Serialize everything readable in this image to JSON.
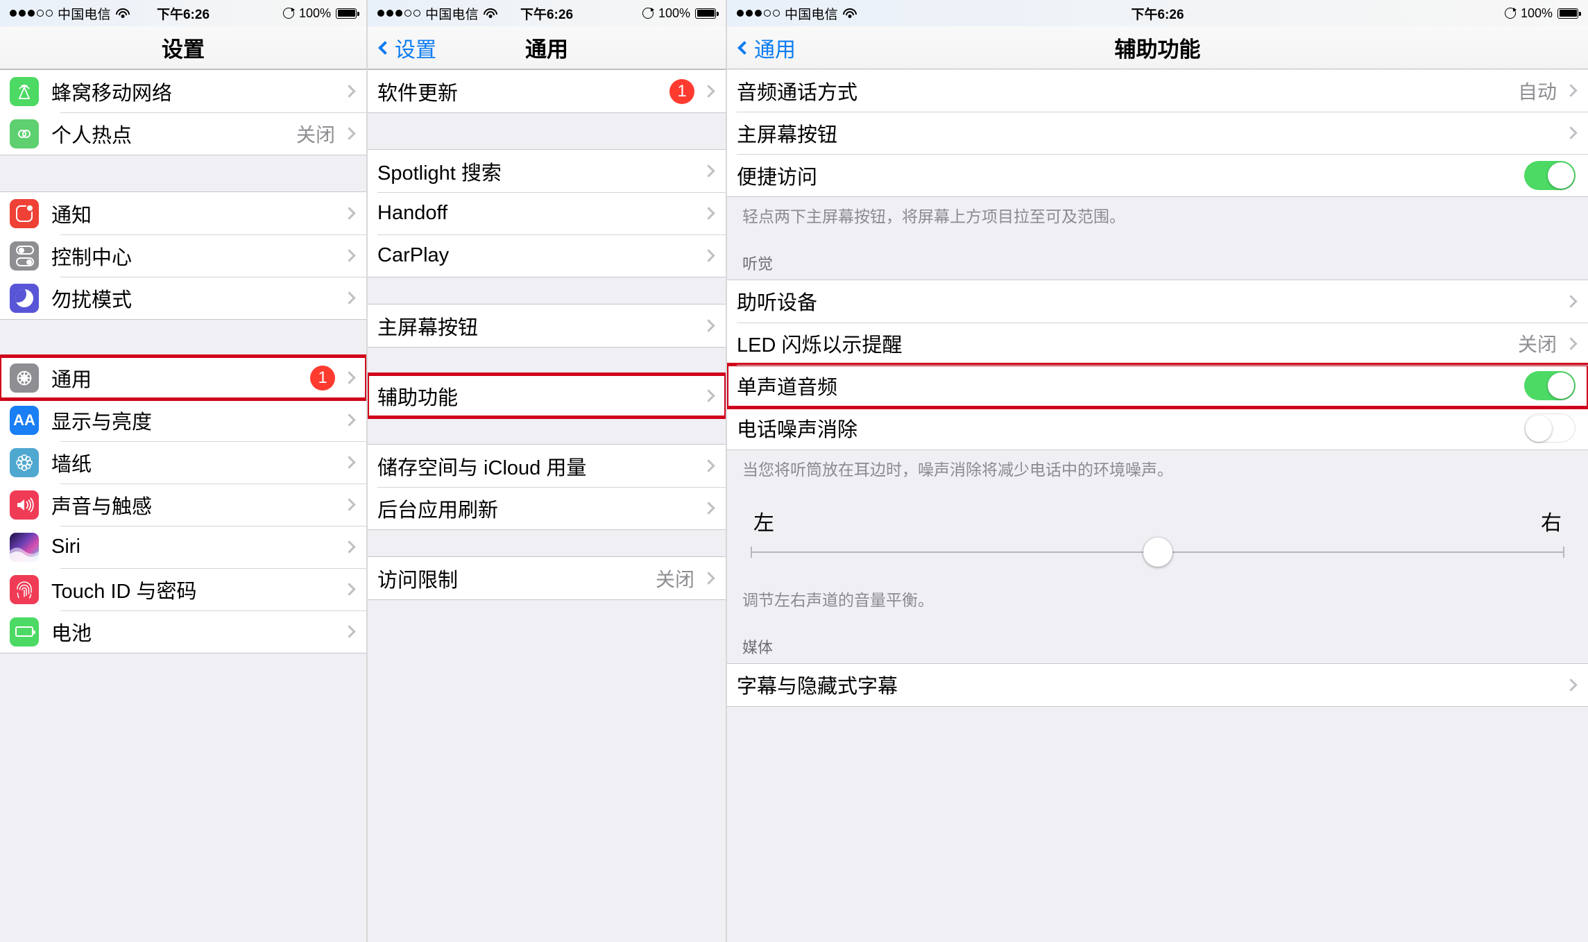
{
  "status_bar": {
    "signal_dots_filled": 3,
    "signal_dots_total": 5,
    "carrier": "中国电信",
    "wifi": "wifi-icon",
    "time": "下午6:26",
    "battery_percent": "100%",
    "orientation_lock": "rotation-lock-icon"
  },
  "panel_settings": {
    "nav": {
      "title": "设置"
    },
    "groups": [
      {
        "rows": [
          {
            "label": "蜂窝移动网络",
            "icon": "cellular-icon",
            "icon_class": "ic-cell",
            "chevron": true
          },
          {
            "label": "个人热点",
            "icon": "hotspot-icon",
            "icon_class": "ic-hotspot",
            "value": "关闭",
            "chevron": true
          }
        ]
      },
      {
        "rows": [
          {
            "label": "通知",
            "icon": "notifications-icon",
            "icon_class": "ic-notif",
            "chevron": true
          },
          {
            "label": "控制中心",
            "icon": "control-center-icon",
            "icon_class": "ic-control",
            "chevron": true
          },
          {
            "label": "勿扰模式",
            "icon": "do-not-disturb-icon",
            "icon_class": "ic-dnd",
            "chevron": true
          }
        ]
      },
      {
        "rows": [
          {
            "label": "通用",
            "icon": "general-gear-icon",
            "icon_class": "ic-general",
            "badge": "1",
            "chevron": true,
            "highlight": true
          },
          {
            "label": "显示与亮度",
            "icon": "display-brightness-icon",
            "icon_class": "ic-display",
            "chevron": true
          },
          {
            "label": "墙纸",
            "icon": "wallpaper-icon",
            "icon_class": "ic-wallpaper",
            "chevron": true
          },
          {
            "label": "声音与触感",
            "icon": "sound-haptics-icon",
            "icon_class": "ic-sound",
            "chevron": true
          },
          {
            "label": "Siri",
            "icon": "siri-icon",
            "icon_class": "ic-siri",
            "chevron": true
          },
          {
            "label": "Touch ID 与密码",
            "icon": "touch-id-icon",
            "icon_class": "ic-touchid",
            "chevron": true
          },
          {
            "label": "电池",
            "icon": "battery-icon",
            "icon_class": "ic-battery",
            "chevron": true
          }
        ]
      }
    ]
  },
  "panel_general": {
    "nav": {
      "back_label": "设置",
      "title": "通用"
    },
    "groups": [
      {
        "rows": [
          {
            "label": "软件更新",
            "badge": "1",
            "chevron": true
          }
        ]
      },
      {
        "rows": [
          {
            "label": "Spotlight 搜索",
            "chevron": true
          },
          {
            "label": "Handoff",
            "chevron": true
          },
          {
            "label": "CarPlay",
            "chevron": true
          }
        ]
      },
      {
        "rows": [
          {
            "label": "主屏幕按钮",
            "chevron": true
          }
        ]
      },
      {
        "rows": [
          {
            "label": "辅助功能",
            "chevron": true,
            "highlight": true
          }
        ]
      },
      {
        "rows": [
          {
            "label": "储存空间与 iCloud 用量",
            "chevron": true
          },
          {
            "label": "后台应用刷新",
            "chevron": true
          }
        ]
      },
      {
        "rows": [
          {
            "label": "访问限制",
            "value": "关闭",
            "chevron": true
          }
        ]
      }
    ]
  },
  "panel_accessibility": {
    "nav": {
      "back_label": "通用",
      "title": "辅助功能"
    },
    "rows_top": [
      {
        "label": "音频通话方式",
        "value": "自动",
        "chevron": true
      },
      {
        "label": "主屏幕按钮",
        "chevron": true
      },
      {
        "label": "便捷访问",
        "toggle": "on"
      }
    ],
    "note_reachability": "轻点两下主屏幕按钮，将屏幕上方项目拉至可及范围。",
    "section_hearing": "听觉",
    "rows_hearing": [
      {
        "label": "助听设备",
        "chevron": true
      },
      {
        "label": "LED 闪烁以示提醒",
        "value": "关闭",
        "chevron": true
      },
      {
        "label": "单声道音频",
        "toggle": "on",
        "highlight": true
      },
      {
        "label": "电话噪声消除",
        "toggle": "off"
      }
    ],
    "note_noise": "当您将听筒放在耳边时，噪声消除将减少电话中的环境噪声。",
    "balance": {
      "left_label": "左",
      "right_label": "右",
      "value_percent": 50
    },
    "note_balance": "调节左右声道的音量平衡。",
    "section_media": "媒体",
    "rows_media": [
      {
        "label": "字幕与隐藏式字幕",
        "chevron": true
      }
    ]
  },
  "colors": {
    "accent_blue": "#0b7bf1",
    "badge_red": "#ff3b30",
    "highlight_red": "#d0021b",
    "toggle_green": "#4cd964",
    "group_bg": "#efeff4"
  }
}
